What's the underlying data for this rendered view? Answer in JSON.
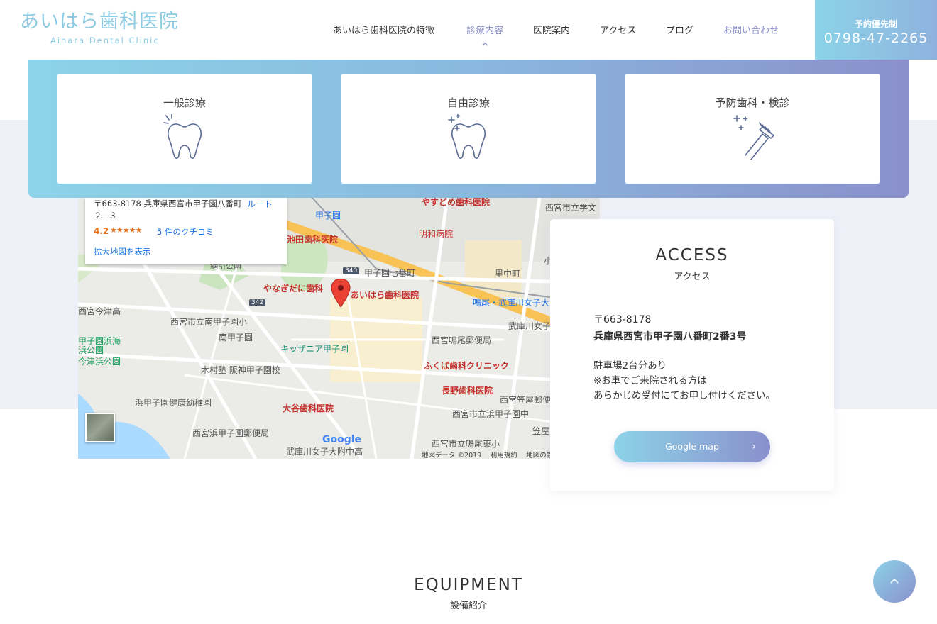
{
  "header": {
    "logo_jp": "あいはら歯科医院",
    "logo_en": "Aihara Dental Clinic",
    "nav": [
      {
        "label": "あいはら歯科医院の特徴"
      },
      {
        "label": "診療内容"
      },
      {
        "label": "医院案内"
      },
      {
        "label": "アクセス"
      },
      {
        "label": "ブログ"
      },
      {
        "label": "お問い合わせ"
      }
    ],
    "tel_label": "予約優先制",
    "tel_number": "0798-47-2265"
  },
  "mega_menu": {
    "cards": [
      {
        "label": "一般診療",
        "icon": "tooth-icon"
      },
      {
        "label": "自由診療",
        "icon": "sparkle-tooth-icon"
      },
      {
        "label": "予防歯科・検診",
        "icon": "toothbrush-icon"
      }
    ]
  },
  "map": {
    "popup": {
      "address": "〒663-8178 兵庫県西宮市甲子園八番町２−３",
      "route": "ルート",
      "rating": "4.2",
      "stars": "★★★★★",
      "reviews": "5 件のクチコミ",
      "enlarge": "拡大地図を表示"
    },
    "labels": {
      "yasudome": "やすどめ歯科医院",
      "nishinomiya_gakubun": "西宮市立学文",
      "koshien_station": "甲子園",
      "showa_hospital": "明和病院",
      "ikeda": "池田歯科医院",
      "koshien_7": "甲子園七番町",
      "satonakacho": "里中町",
      "park": "網引公園",
      "yanagidani": "やなぎだに歯科",
      "aihara": "あいはら歯科医院",
      "naruo_station": "鳴尾・武庫川女子大",
      "imazu_high": "西宮今津高",
      "minami_koshien_elem": "西宮市立南甲子園小",
      "minami_koshien": "南甲子園",
      "mukogawa_women": "武庫川女子",
      "kidzania": "キッザニア甲子園",
      "naruo_post": "西宮鳴尾郵便局",
      "hama_park": "甲子園浜海浜公園",
      "tsu_park": "今津浜公園",
      "kimura": "木村塾 阪神甲子園校",
      "fukuba": "ふくば歯科クリニック",
      "nagano": "長野歯科医院",
      "kasaya_post": "西宮笠屋郵便局",
      "hama_kindergarten": "浜甲子園健康幼稚園",
      "ooya": "大谷歯科医院",
      "koshien_junior": "西宮市立浜甲子園中",
      "hama_post": "西宮浜甲子園郵便局",
      "naruo_east": "西宮市立鳴尾東小",
      "mukogawa_high": "武庫川女子大附中高",
      "road_340": "340",
      "road_342": "342",
      "kasaya_short": "笠屋",
      "ko_short": "小"
    },
    "google": "Google",
    "footer": "地図データ ©2019　 利用規約　 地図の誤"
  },
  "access": {
    "title_en": "ACCESS",
    "title_jp": "アクセス",
    "zip": "〒663-8178",
    "address": "兵庫県西宮市甲子園八番町2番3号",
    "note_1": "駐車場2台分あり",
    "note_2": "※お車でご来院される方は",
    "note_3": "あらかじめ受付にてお申し付けください。",
    "button": "Google map"
  },
  "equipment": {
    "title_en": "EQUIPMENT",
    "title_jp": "設備紹介"
  },
  "colors": {
    "accent_cyan": "#8cd3e8",
    "accent_purple": "#8a90cc",
    "band_grey": "#eff1f9"
  }
}
